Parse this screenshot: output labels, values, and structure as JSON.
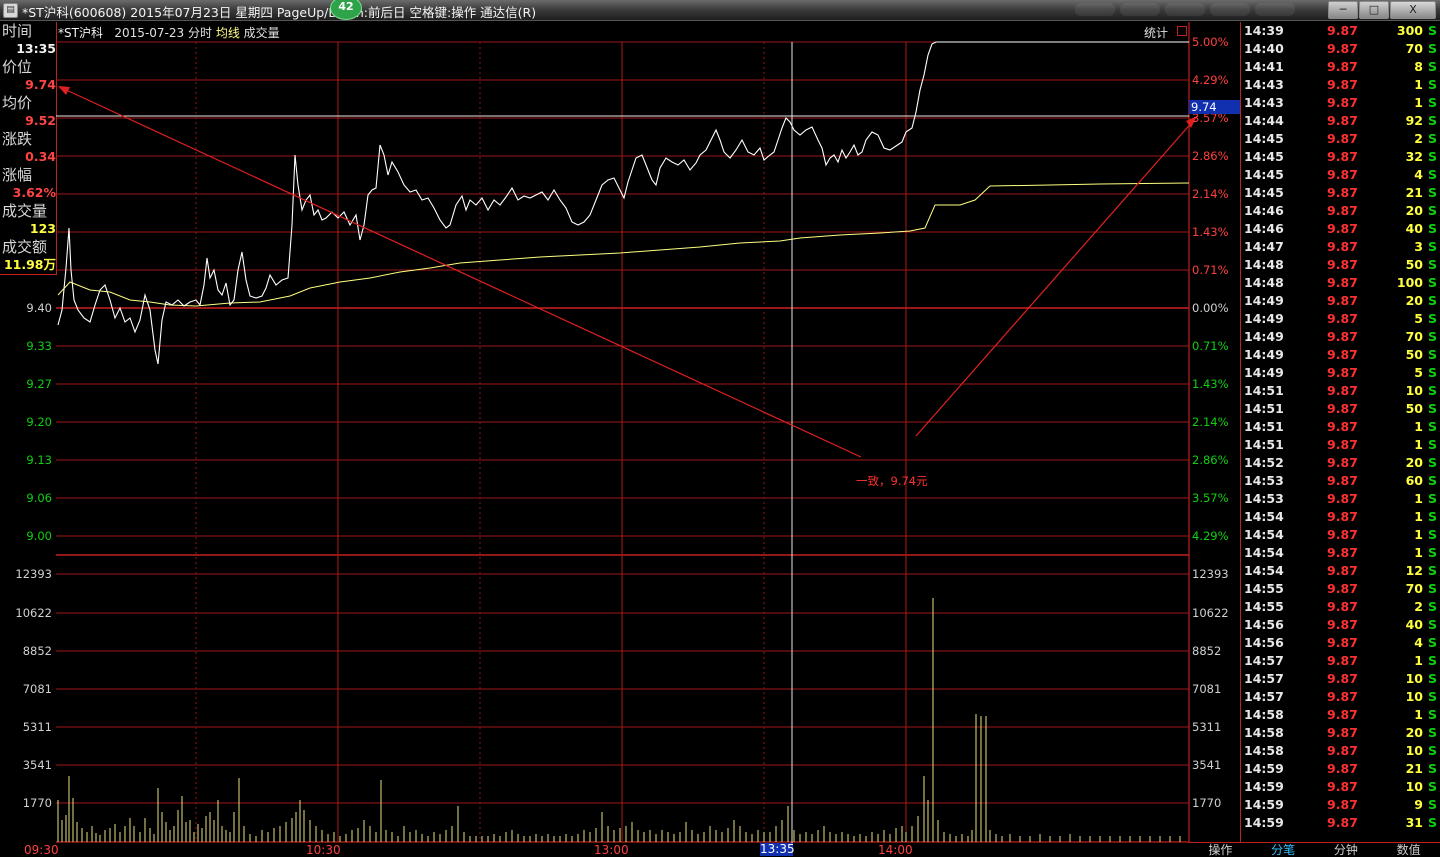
{
  "window": {
    "title": "*ST沪科(600608) 2015年07月23日 星期四 PageUp/Down:前后日 空格键:操作 通达信(R)",
    "badge": "42",
    "buttons": {
      "minimize": "─",
      "restore": "□",
      "close": "X"
    }
  },
  "info_panel": {
    "time_label": "时间",
    "time_value": "13:35",
    "price_label": "价位",
    "price_value": "9.74",
    "avg_label": "均价",
    "avg_value": "9.52",
    "change_label": "涨跌",
    "change_value": "0.34",
    "pct_label": "涨幅",
    "pct_value": "3.62%",
    "vol_label": "成交量",
    "vol_value": "123",
    "amt_label": "成交额",
    "amt_value": "11.98万"
  },
  "chart_header": {
    "name": "*ST沪科",
    "date": "2015-07-23",
    "mode": "分时",
    "avg_line": "均线",
    "volume": "成交量",
    "stat": "统计"
  },
  "price_axis_left": [
    {
      "label": "9.40",
      "color": "white"
    },
    {
      "label": "9.33",
      "color": "green"
    },
    {
      "label": "9.27",
      "color": "green"
    },
    {
      "label": "9.20",
      "color": "green"
    },
    {
      "label": "9.13",
      "color": "green"
    },
    {
      "label": "9.06",
      "color": "green"
    },
    {
      "label": "9.00",
      "color": "green"
    }
  ],
  "pct_axis_right": [
    {
      "label": "5.00%",
      "color": "red"
    },
    {
      "label": "4.29%",
      "color": "red"
    },
    {
      "label": "3.57%",
      "color": "red"
    },
    {
      "label": "2.86%",
      "color": "red"
    },
    {
      "label": "2.14%",
      "color": "red"
    },
    {
      "label": "1.43%",
      "color": "red"
    },
    {
      "label": "0.71%",
      "color": "red"
    },
    {
      "label": "0.00%",
      "color": "white"
    },
    {
      "label": "0.71%",
      "color": "green"
    },
    {
      "label": "1.43%",
      "color": "green"
    },
    {
      "label": "2.14%",
      "color": "green"
    },
    {
      "label": "2.86%",
      "color": "green"
    },
    {
      "label": "3.57%",
      "color": "green"
    },
    {
      "label": "4.29%",
      "color": "green"
    }
  ],
  "volume_axis": [
    "12393",
    "10622",
    "8852",
    "7081",
    "5311",
    "3541",
    "1770"
  ],
  "time_axis": [
    "09:30",
    "10:30",
    "13:00",
    "14:00"
  ],
  "cursor_time": "13:35",
  "cursor_price_tag": "9.74",
  "annotation": "一致，9.74元",
  "ticks": [
    {
      "t": "14:39",
      "p": "9.87",
      "v": "300",
      "s": "S"
    },
    {
      "t": "14:40",
      "p": "9.87",
      "v": "70",
      "s": "S"
    },
    {
      "t": "14:41",
      "p": "9.87",
      "v": "8",
      "s": "S"
    },
    {
      "t": "14:43",
      "p": "9.87",
      "v": "1",
      "s": "S"
    },
    {
      "t": "14:43",
      "p": "9.87",
      "v": "1",
      "s": "S"
    },
    {
      "t": "14:44",
      "p": "9.87",
      "v": "92",
      "s": "S"
    },
    {
      "t": "14:45",
      "p": "9.87",
      "v": "2",
      "s": "S"
    },
    {
      "t": "14:45",
      "p": "9.87",
      "v": "32",
      "s": "S"
    },
    {
      "t": "14:45",
      "p": "9.87",
      "v": "4",
      "s": "S"
    },
    {
      "t": "14:45",
      "p": "9.87",
      "v": "21",
      "s": "S"
    },
    {
      "t": "14:46",
      "p": "9.87",
      "v": "20",
      "s": "S"
    },
    {
      "t": "14:46",
      "p": "9.87",
      "v": "40",
      "s": "S"
    },
    {
      "t": "14:47",
      "p": "9.87",
      "v": "3",
      "s": "S"
    },
    {
      "t": "14:48",
      "p": "9.87",
      "v": "50",
      "s": "S"
    },
    {
      "t": "14:48",
      "p": "9.87",
      "v": "100",
      "s": "S"
    },
    {
      "t": "14:49",
      "p": "9.87",
      "v": "20",
      "s": "S"
    },
    {
      "t": "14:49",
      "p": "9.87",
      "v": "5",
      "s": "S"
    },
    {
      "t": "14:49",
      "p": "9.87",
      "v": "70",
      "s": "S"
    },
    {
      "t": "14:49",
      "p": "9.87",
      "v": "50",
      "s": "S"
    },
    {
      "t": "14:49",
      "p": "9.87",
      "v": "5",
      "s": "S"
    },
    {
      "t": "14:51",
      "p": "9.87",
      "v": "10",
      "s": "S"
    },
    {
      "t": "14:51",
      "p": "9.87",
      "v": "50",
      "s": "S"
    },
    {
      "t": "14:51",
      "p": "9.87",
      "v": "1",
      "s": "S"
    },
    {
      "t": "14:51",
      "p": "9.87",
      "v": "1",
      "s": "S"
    },
    {
      "t": "14:52",
      "p": "9.87",
      "v": "20",
      "s": "S"
    },
    {
      "t": "14:53",
      "p": "9.87",
      "v": "60",
      "s": "S"
    },
    {
      "t": "14:53",
      "p": "9.87",
      "v": "1",
      "s": "S"
    },
    {
      "t": "14:54",
      "p": "9.87",
      "v": "1",
      "s": "S"
    },
    {
      "t": "14:54",
      "p": "9.87",
      "v": "1",
      "s": "S"
    },
    {
      "t": "14:54",
      "p": "9.87",
      "v": "1",
      "s": "S"
    },
    {
      "t": "14:54",
      "p": "9.87",
      "v": "12",
      "s": "S"
    },
    {
      "t": "14:55",
      "p": "9.87",
      "v": "70",
      "s": "S"
    },
    {
      "t": "14:55",
      "p": "9.87",
      "v": "2",
      "s": "S"
    },
    {
      "t": "14:56",
      "p": "9.87",
      "v": "40",
      "s": "S"
    },
    {
      "t": "14:56",
      "p": "9.87",
      "v": "4",
      "s": "S"
    },
    {
      "t": "14:57",
      "p": "9.87",
      "v": "1",
      "s": "S"
    },
    {
      "t": "14:57",
      "p": "9.87",
      "v": "10",
      "s": "S"
    },
    {
      "t": "14:57",
      "p": "9.87",
      "v": "10",
      "s": "S"
    },
    {
      "t": "14:58",
      "p": "9.87",
      "v": "1",
      "s": "S"
    },
    {
      "t": "14:58",
      "p": "9.87",
      "v": "20",
      "s": "S"
    },
    {
      "t": "14:58",
      "p": "9.87",
      "v": "10",
      "s": "S"
    },
    {
      "t": "14:59",
      "p": "9.87",
      "v": "21",
      "s": "S"
    },
    {
      "t": "14:59",
      "p": "9.87",
      "v": "10",
      "s": "S"
    },
    {
      "t": "14:59",
      "p": "9.87",
      "v": "9",
      "s": "S"
    },
    {
      "t": "14:59",
      "p": "9.87",
      "v": "31",
      "s": "S"
    }
  ],
  "bottom_tabs": [
    {
      "label": "操作",
      "active": false
    },
    {
      "label": "分笔",
      "active": true
    },
    {
      "label": "分钟",
      "active": false
    },
    {
      "label": "数值",
      "active": false
    }
  ],
  "colors": {
    "grid": "#b01818",
    "price_line": "#ffffff",
    "avg_line": "#ffff80",
    "up": "#ff4040",
    "down": "#10d010",
    "cursor_bg": "#1030b0"
  }
}
